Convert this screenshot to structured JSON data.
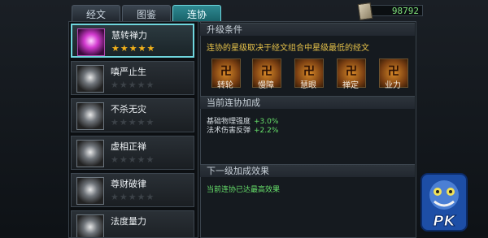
{
  "tabs": [
    "经文",
    "图鉴",
    "连协"
  ],
  "active_tab": 2,
  "currency": {
    "amount": "98792"
  },
  "skills": [
    {
      "name": "慧转禅力",
      "stars": "★★★★★",
      "selected": true
    },
    {
      "name": "嗔严止生",
      "stars": "★★★★★",
      "selected": false
    },
    {
      "name": "不杀无灾",
      "stars": "★★★★★",
      "selected": false
    },
    {
      "name": "虚相正禅",
      "stars": "★★★★★",
      "selected": false
    },
    {
      "name": "尊财破律",
      "stars": "★★★★★",
      "selected": false
    },
    {
      "name": "法度量力",
      "stars": "",
      "selected": false
    }
  ],
  "upgrade": {
    "header": "升级条件",
    "desc": "连协的星级取决于经文组合中星级最低的经文",
    "runes": [
      {
        "glyph": "卍",
        "label": "转轮"
      },
      {
        "glyph": "卍",
        "label": "慢障"
      },
      {
        "glyph": "卍",
        "label": "慧眼"
      },
      {
        "glyph": "卍",
        "label": "禅定"
      },
      {
        "glyph": "卍",
        "label": "业力"
      }
    ]
  },
  "current": {
    "header": "当前连协加成",
    "stats": [
      {
        "name": "基础物理强度",
        "value": "+3.0%"
      },
      {
        "name": "法术伤害反弹",
        "value": "+2.2%"
      }
    ]
  },
  "next": {
    "header": "下一级加成效果",
    "text": "当前连协已达最高效果"
  },
  "badge": {
    "text": "PK"
  }
}
